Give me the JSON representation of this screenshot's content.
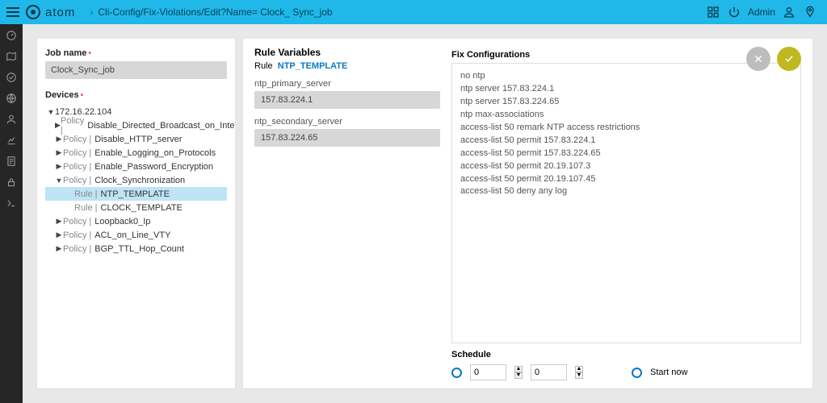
{
  "header": {
    "brand": "atom",
    "breadcrumb": "Cli-Config/Fix-Violations/Edit?Name= Clock_ Sync_job",
    "user": "Admin"
  },
  "form": {
    "job_name_label": "Job name",
    "job_name_value": "Clock_Sync_job",
    "devices_label": "Devices"
  },
  "tree": {
    "root": "172.16.22.104",
    "policy_prefix": "Policy |",
    "rule_prefix": "Rule |",
    "items": [
      {
        "type": "policy",
        "label": "Disable_Directed_Broadcast_on_Interfaces"
      },
      {
        "type": "policy",
        "label": "Disable_HTTP_server"
      },
      {
        "type": "policy",
        "label": "Enable_Logging_on_Protocols"
      },
      {
        "type": "policy",
        "label": "Enable_Password_Encryption"
      },
      {
        "type": "policy",
        "label": "Clock_Synchronization",
        "expanded": true,
        "children": [
          {
            "type": "rule",
            "label": "NTP_TEMPLATE",
            "selected": true
          },
          {
            "type": "rule",
            "label": "CLOCK_TEMPLATE"
          }
        ]
      },
      {
        "type": "policy",
        "label": "Loopback0_Ip"
      },
      {
        "type": "policy",
        "label": "ACL_on_Line_VTY"
      },
      {
        "type": "policy",
        "label": "BGP_TTL_Hop_Count"
      }
    ]
  },
  "vars": {
    "title": "Rule Variables",
    "rule_label": "Rule",
    "rule_value": "NTP_TEMPLATE",
    "v1_label": "ntp_primary_server",
    "v1_value": "157.83.224.1",
    "v2_label": "ntp_secondary_server",
    "v2_value": "157.83.224.65"
  },
  "fix": {
    "label": "Fix Configurations",
    "text": "no ntp\nntp server 157.83.224.1\nntp server 157.83.224.65\nntp max-associations\naccess-list 50 remark NTP access restrictions\naccess-list 50 permit 157.83.224.1\naccess-list 50 permit 157.83.224.65\naccess-list 50 permit 20.19.107.3\naccess-list 50 permit 20.19.107.45\naccess-list 50 deny any log"
  },
  "schedule": {
    "label": "Schedule",
    "hours": "0",
    "minutes": "0",
    "start_now": "Start now"
  }
}
